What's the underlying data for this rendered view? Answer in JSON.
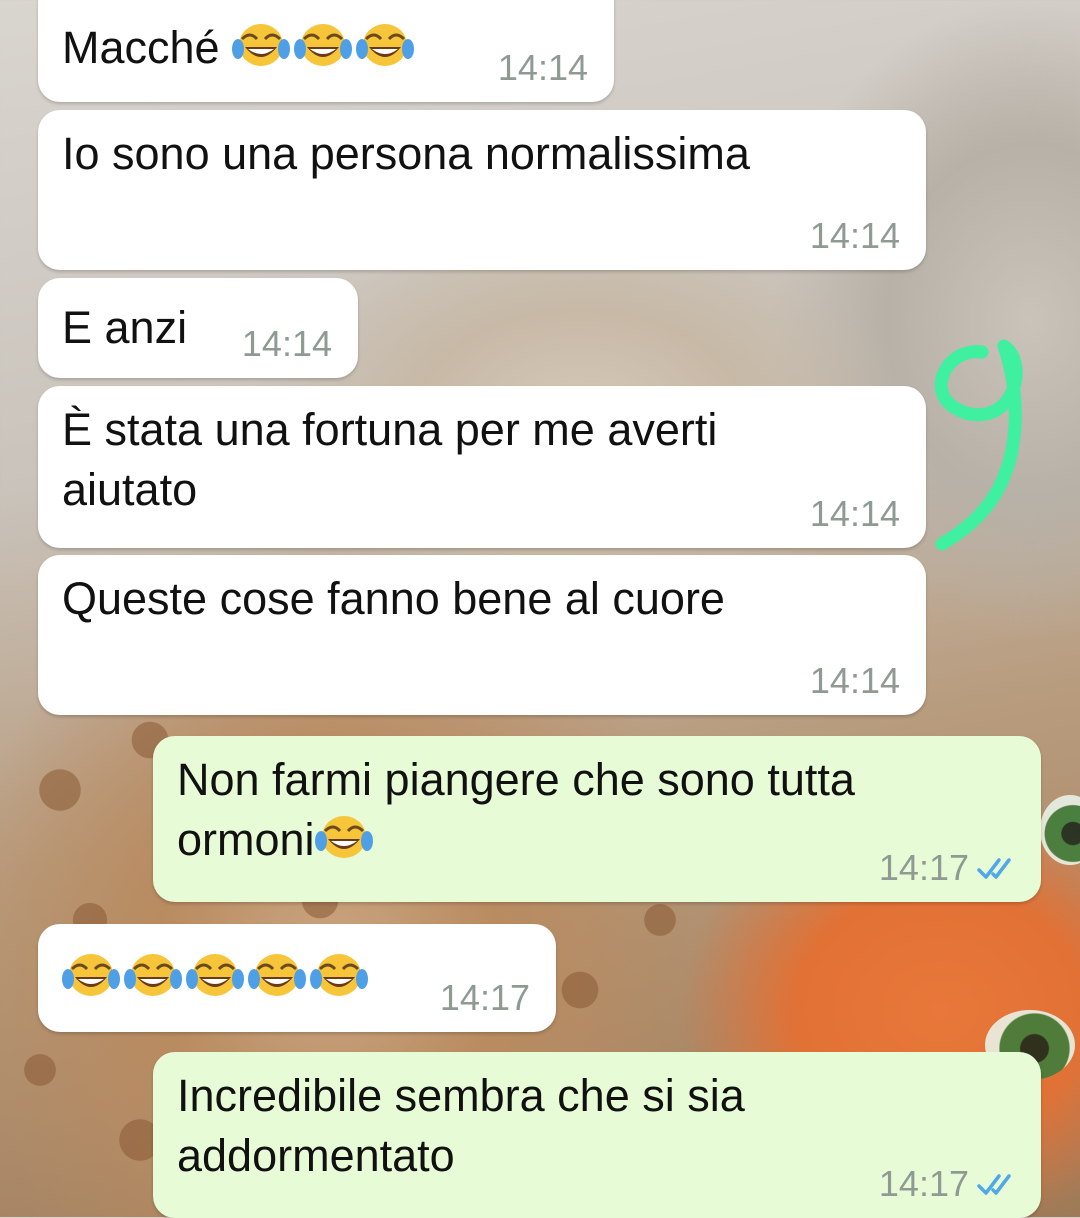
{
  "chat": {
    "messages": [
      {
        "direction": "in",
        "text": "Macché",
        "emoji_after": [
          "face-with-tears-of-joy-emoji",
          "face-with-tears-of-joy-emoji",
          "face-with-tears-of-joy-emoji"
        ],
        "time": "14:14"
      },
      {
        "direction": "in",
        "text": "Io sono una persona normalissima",
        "time": "14:14"
      },
      {
        "direction": "in",
        "text": "E anzi",
        "time": "14:14"
      },
      {
        "direction": "in",
        "text": "È stata una fortuna per me averti aiutato",
        "time": "14:14"
      },
      {
        "direction": "in",
        "text": "Queste cose fanno bene al cuore",
        "time": "14:14"
      },
      {
        "direction": "out",
        "text": "Non farmi piangere che sono tutta ormoni",
        "emoji_after": [
          "face-with-tears-of-joy-emoji"
        ],
        "time": "14:17",
        "status": "read"
      },
      {
        "direction": "in",
        "text": "",
        "emoji_after": [
          "face-with-tears-of-joy-emoji",
          "face-with-tears-of-joy-emoji",
          "face-with-tears-of-joy-emoji",
          "face-with-tears-of-joy-emoji",
          "face-with-tears-of-joy-emoji"
        ],
        "time": "14:17"
      },
      {
        "direction": "out",
        "text": "Incredibile sembra che si sia addormentato",
        "time": "14:17",
        "status": "read"
      }
    ]
  },
  "annotation": {
    "text": "9",
    "color": "#3ff0a0"
  },
  "colors": {
    "incoming_bubble": "#ffffff",
    "outgoing_bubble": "#e7fcd6",
    "timestamp": "#8f9a92",
    "read_ticks": "#4fa8e8"
  },
  "icons": {
    "read_receipt": "double-check-icon"
  }
}
